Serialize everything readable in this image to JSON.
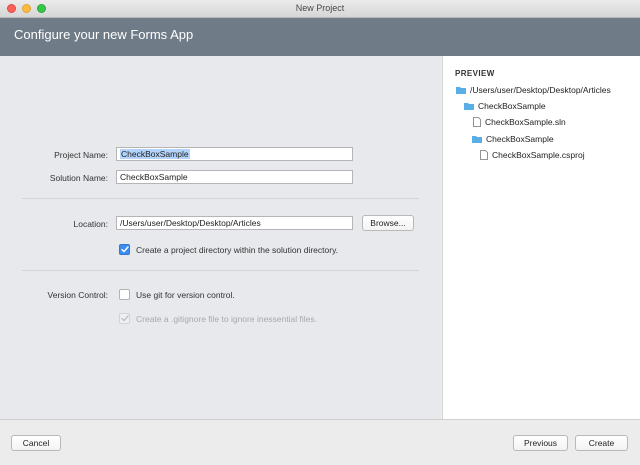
{
  "window": {
    "title": "New Project"
  },
  "header": {
    "title": "Configure your new Forms App"
  },
  "form": {
    "project_name_label": "Project Name:",
    "project_name_value": "CheckBoxSample",
    "solution_name_label": "Solution Name:",
    "solution_name_value": "CheckBoxSample",
    "location_label": "Location:",
    "location_value": "/Users/user/Desktop/Desktop/Articles",
    "browse_label": "Browse...",
    "create_dir_label": "Create a project directory within the solution directory.",
    "create_dir_checked": true,
    "version_control_label": "Version Control:",
    "use_git_label": "Use git for version control.",
    "use_git_checked": false,
    "gitignore_label": "Create a .gitignore file to ignore inessential files.",
    "gitignore_checked": true,
    "gitignore_enabled": false
  },
  "preview": {
    "title": "PREVIEW",
    "tree": [
      {
        "type": "folder",
        "label": "/Users/user/Desktop/Desktop/Articles",
        "icon": "folder-icon"
      },
      {
        "type": "folder",
        "label": "CheckBoxSample",
        "icon": "folder-icon"
      },
      {
        "type": "file",
        "label": "CheckBoxSample.sln",
        "icon": "file-icon"
      },
      {
        "type": "folder",
        "label": "CheckBoxSample",
        "icon": "folder-icon"
      },
      {
        "type": "file",
        "label": "CheckBoxSample.csproj",
        "icon": "file-icon"
      }
    ]
  },
  "footer": {
    "cancel_label": "Cancel",
    "previous_label": "Previous",
    "create_label": "Create"
  },
  "colors": {
    "header_bg": "#6f7b86",
    "accent": "#3b8ef0",
    "folder": "#5aaee6",
    "selection": "#b3d4fc"
  }
}
